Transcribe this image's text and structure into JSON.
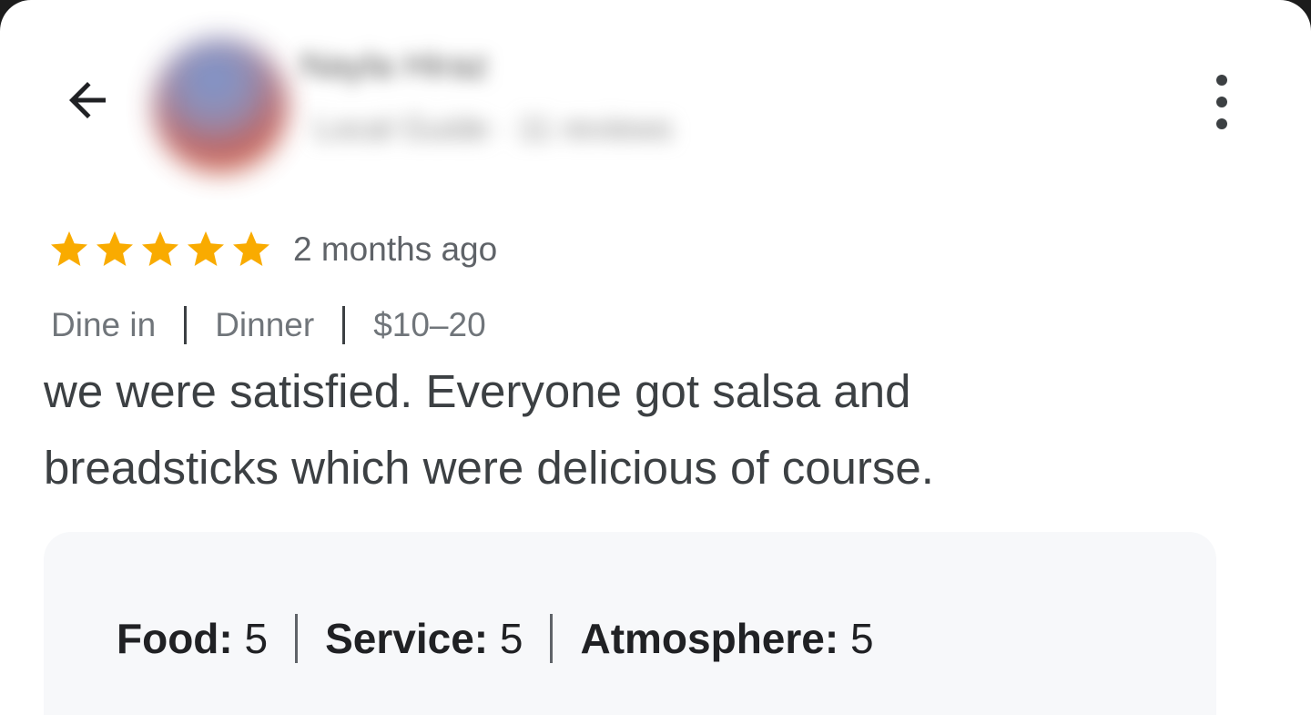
{
  "header": {
    "back_icon": "arrow-left-icon",
    "reviewer_name": "Nayla Hiraz",
    "reviewer_meta": "Local Guide · 11 reviews",
    "more_icon": "more-vert-icon"
  },
  "review": {
    "star_count": 5,
    "star_color": "#f9ab00",
    "time_ago": "2 months ago",
    "tags": [
      {
        "label": "Dine in"
      },
      {
        "label": "Dinner"
      },
      {
        "label": "$10–20"
      }
    ],
    "text_line1": "we were satisfied. Everyone got salsa and",
    "text_line2": "breadsticks which were delicious of course."
  },
  "sub_ratings": [
    {
      "label": "Food:",
      "value": "5"
    },
    {
      "label": "Service:",
      "value": "5"
    },
    {
      "label": "Atmosphere:",
      "value": "5"
    }
  ]
}
